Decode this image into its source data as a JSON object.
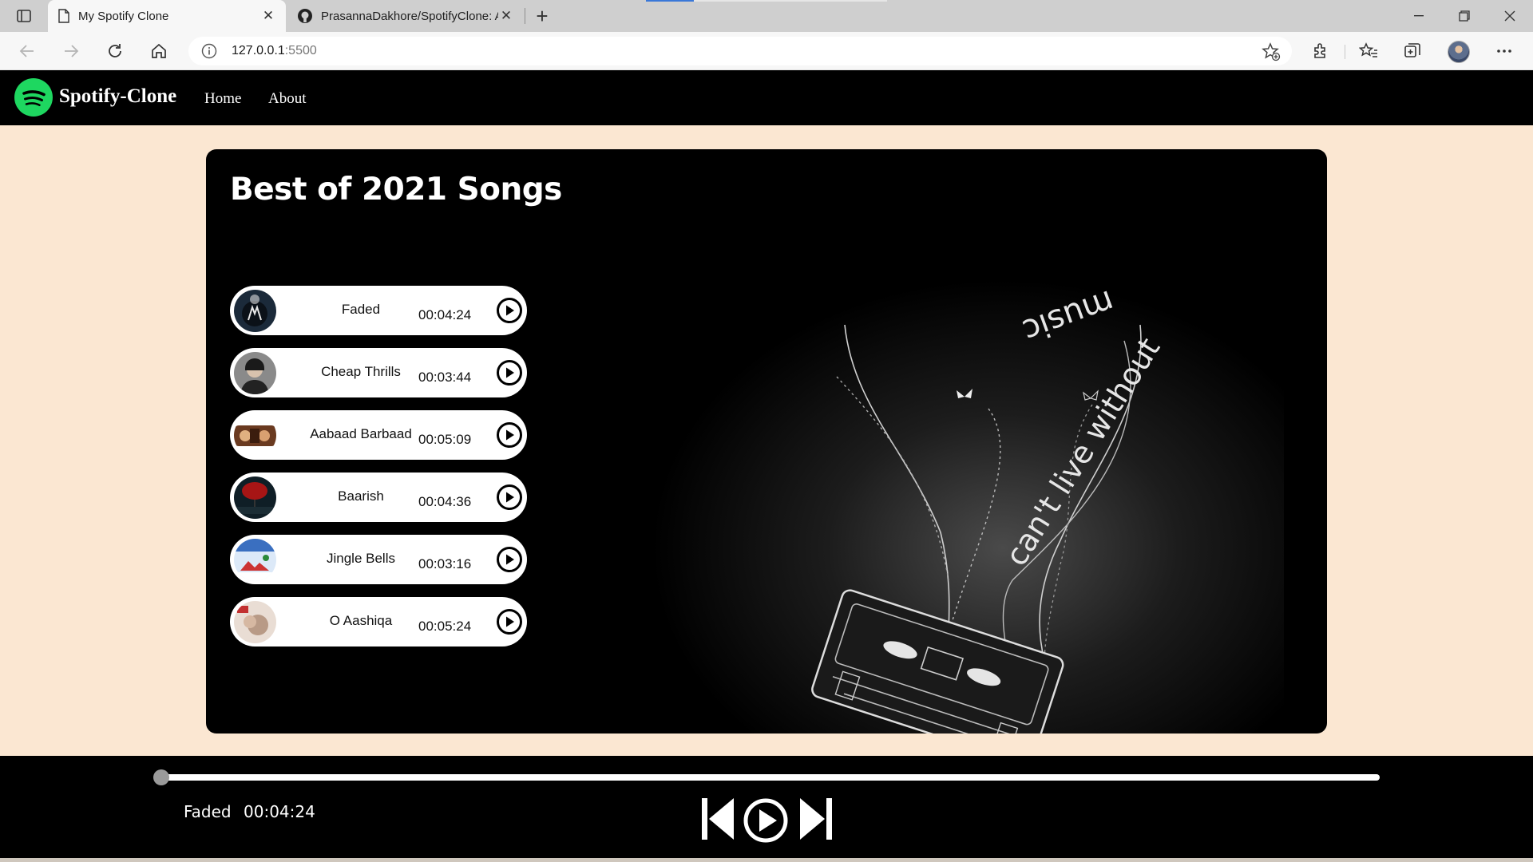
{
  "browser": {
    "tabs": [
      {
        "title": "My Spotify Clone",
        "active": true
      },
      {
        "title": "PrasannaDakhore/SpotifyClone: A",
        "active": false
      }
    ],
    "address": {
      "host": "127.0.0.1",
      "port": ":5500"
    }
  },
  "site": {
    "brand": "Spotify-Clone",
    "nav": [
      {
        "label": "Home"
      },
      {
        "label": "About"
      }
    ],
    "heading": "Best of 2021 Songs"
  },
  "songs": [
    {
      "name": "Faded",
      "duration": "00:04:24",
      "cover_color": "#1b2a3a"
    },
    {
      "name": "Cheap Thrills",
      "duration": "00:03:44",
      "cover_color": "#6d6d6d"
    },
    {
      "name": "Aabaad Barbaad",
      "duration": "00:05:09",
      "cover_color": "#6a3a20"
    },
    {
      "name": "Baarish",
      "duration": "00:04:36",
      "cover_color": "#7a1010"
    },
    {
      "name": "Jingle Bells",
      "duration": "00:03:16",
      "cover_color": "#3a6fc0"
    },
    {
      "name": "O Aashiqa",
      "duration": "00:05:24",
      "cover_color": "#b89a86"
    }
  ],
  "player": {
    "current_song": "Faded",
    "current_time": "00:04:24",
    "progress": 0
  },
  "colors": {
    "accent": "#1ed760",
    "page_bg": "#fbe7d2"
  }
}
